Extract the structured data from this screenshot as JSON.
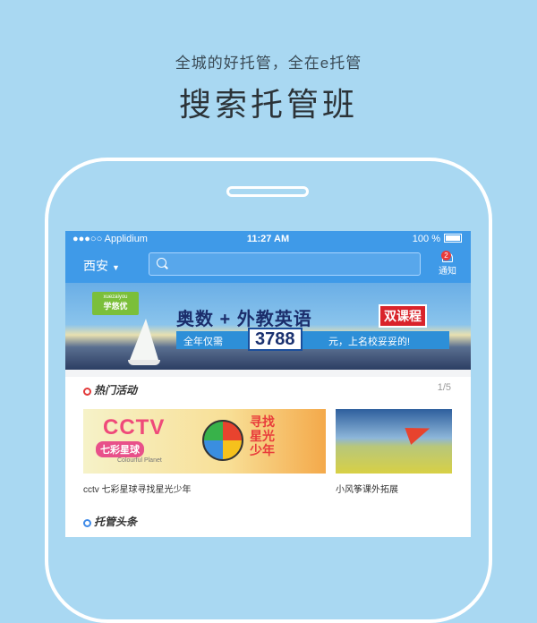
{
  "promo": {
    "subtitle": "全城的好托管，全在e托管",
    "title": "搜索托管班"
  },
  "statusbar": {
    "carrier": "●●●○○ Applidium",
    "time": "11:27 AM",
    "battery": "100 %"
  },
  "navbar": {
    "city": "西安",
    "notice_label": "通知",
    "notice_count": "2",
    "search_placeholder": ""
  },
  "banner": {
    "logo_top": "xuezaiyou",
    "logo_name": "学悠优",
    "headline": "奥数 + 外教英语",
    "tag": "双课程",
    "sub_pre": "全年仅需",
    "price": "3788",
    "sub_post": "元，上名校妥妥的!",
    "active_dot": 1
  },
  "hot": {
    "title": "热门活动",
    "count": "1/5",
    "cards": [
      {
        "brand": "CCTV",
        "sub": "七彩星球",
        "en": "Colourful Planet",
        "slogan_1": "寻找",
        "slogan_2": "星光",
        "slogan_3": "少年",
        "caption": "cctv 七彩星球寻找星光少年"
      },
      {
        "caption": "小风筝课外拓展"
      }
    ]
  },
  "news": {
    "title": "托管头条"
  },
  "colors": {
    "bg": "#a9d8f2",
    "accent": "#3f9ae8",
    "badge": "#e83b3b"
  }
}
